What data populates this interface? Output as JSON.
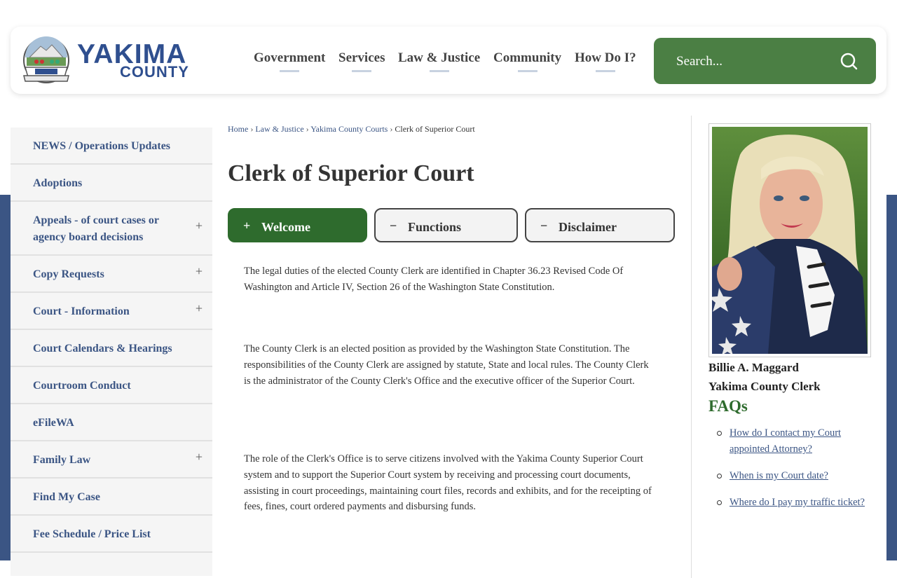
{
  "header": {
    "logo": {
      "line1": "YAKIMA",
      "line2": "COUNTY",
      "seal_text": "YAKIMA COUNTY"
    },
    "nav": [
      "Government",
      "Services",
      "Law & Justice",
      "Community",
      "How Do I?"
    ],
    "search": {
      "placeholder": "Search..."
    }
  },
  "sidebar": {
    "items": [
      {
        "label": "NEWS / Operations Updates",
        "expandable": false
      },
      {
        "label": "Adoptions",
        "expandable": false
      },
      {
        "label": "Appeals - of court cases or agency board decisions",
        "expandable": true
      },
      {
        "label": "Copy Requests",
        "expandable": true
      },
      {
        "label": "Court - Information",
        "expandable": true
      },
      {
        "label": "Court Calendars & Hearings",
        "expandable": false
      },
      {
        "label": "Courtroom Conduct",
        "expandable": false
      },
      {
        "label": "eFileWA",
        "expandable": false
      },
      {
        "label": "Family Law",
        "expandable": true
      },
      {
        "label": "Find My Case",
        "expandable": false
      },
      {
        "label": "Fee Schedule / Price List",
        "expandable": false
      }
    ],
    "plus_glyph": "+"
  },
  "breadcrumb": {
    "items": [
      "Home",
      "Law & Justice",
      "Yakima County Courts"
    ],
    "current": "Clerk of Superior Court",
    "separator": "›"
  },
  "page": {
    "title": "Clerk of Superior Court",
    "tabs": [
      {
        "label": "Welcome",
        "sign": "+",
        "active": true
      },
      {
        "label": "Functions",
        "sign": "−",
        "active": false
      },
      {
        "label": "Disclaimer",
        "sign": "−",
        "active": false
      }
    ],
    "paragraphs": [
      "The legal duties of the elected County Clerk are identified in Chapter 36.23 Revised Code Of Washington and Article IV, Section 26 of the Washington State Constitution.",
      "The County Clerk is an elected position as provided by the Washington State Constitution. The responsibilities of the County Clerk are assigned by statute, State and local rules. The County Clerk is the administrator of the County Clerk's Office and the executive officer of the Superior Court.",
      "The role of the Clerk's Office is to serve citizens involved with the Yakima County Superior Court system and to support the Superior Court system by receiving and processing court documents, assisting in court proceedings, maintaining court files, records and exhibits, and for the receipting of fees, fines, court ordered payments and disbursing funds."
    ]
  },
  "rightcol": {
    "name": "Billie A. Maggard",
    "title": "Yakima County Clerk",
    "faq_heading": "FAQs",
    "faqs": [
      "How do I contact my Court appointed Attorney?",
      "When is my Court date?",
      "Where do I pay my traffic ticket?"
    ]
  },
  "colors": {
    "brand_blue": "#2f4f8f",
    "link_blue": "#3b5584",
    "brand_green": "#4b7f44",
    "tab_active_green": "#2e6b2d",
    "band_blue": "#3b5584"
  }
}
